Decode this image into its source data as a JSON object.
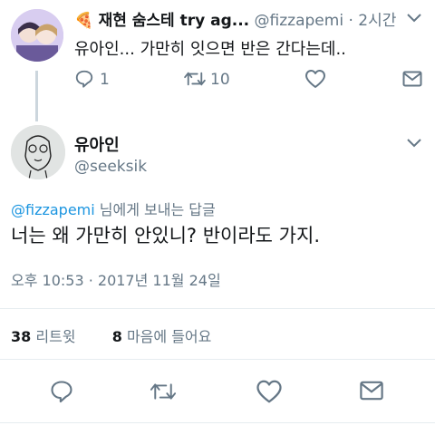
{
  "parent_tweet": {
    "author_emoji": "🍕",
    "author_name": "재현 숨스테 try ag...",
    "handle": "@fizzapemi",
    "separator": "·",
    "time": "2시간",
    "text": "유아인... 가만히 잇으면 반은 간다는데..",
    "reply_count": "1",
    "retweet_count": "10"
  },
  "main_tweet": {
    "author_name": "유아인",
    "handle": "@seeksik",
    "reply_to_handle": "@fizzapemi",
    "reply_to_suffix": " 님에게 보내는 답글",
    "text": "너는 왜 가만히 안있니? 반이라도 가지.",
    "timestamp": "오후 10:53 · 2017년 11월 24일",
    "retweets_count": "38",
    "retweets_label": "리트윗",
    "likes_count": "8",
    "likes_label": "마음에 들어요"
  },
  "icons": {
    "reply": "reply-icon",
    "retweet": "retweet-icon",
    "like": "heart-icon",
    "dm": "envelope-icon",
    "more": "chevron-down-icon"
  },
  "colors": {
    "link": "#1b95e0",
    "muted": "#657786",
    "text": "#14171a",
    "divider": "#e6ecf0"
  }
}
